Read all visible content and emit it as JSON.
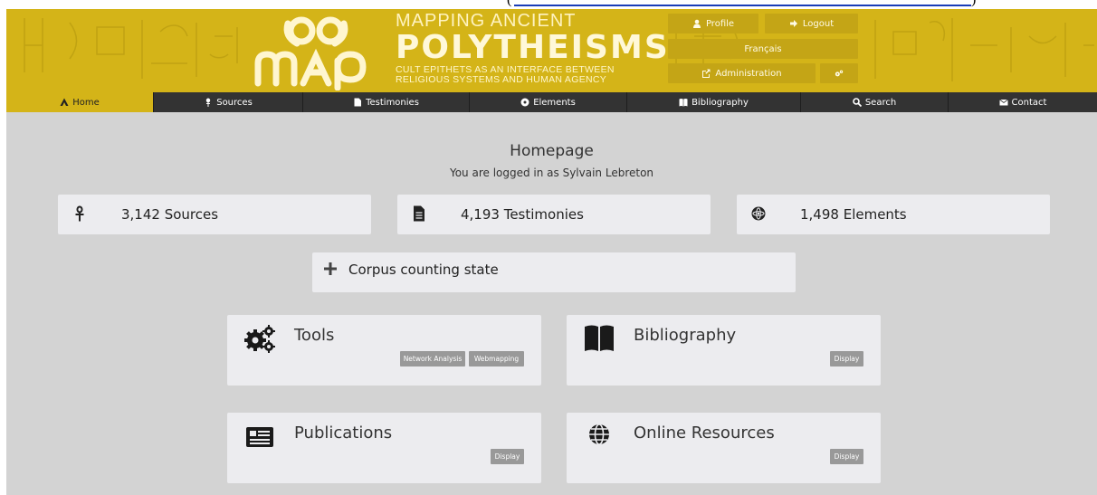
{
  "header": {
    "brand": {
      "line1": "MAPPING ANCIENT",
      "line2": "POLYTHEISMS",
      "line3": "CULT EPITHETS AS AN INTERFACE BETWEEN",
      "line4": "RELIGIOUS SYSTEMS AND HUMAN AGENCY"
    },
    "buttons": {
      "profile": "Profile",
      "logout": "Logout",
      "language": "Français",
      "administration": "Administration"
    }
  },
  "nav": {
    "items": [
      {
        "label": "Home",
        "icon": "home-icon",
        "active": true
      },
      {
        "label": "Sources",
        "icon": "ankh-icon"
      },
      {
        "label": "Testimonies",
        "icon": "document-icon"
      },
      {
        "label": "Elements",
        "icon": "atom-icon"
      },
      {
        "label": "Bibliography",
        "icon": "book-icon"
      },
      {
        "label": "Search",
        "icon": "search-icon"
      },
      {
        "label": "Contact",
        "icon": "envelope-icon"
      }
    ]
  },
  "main": {
    "title": "Homepage",
    "logged_in": "You are logged in as Sylvain Lebreton",
    "stats": {
      "sources": "3,142 Sources",
      "testimonies": "4,193 Testimonies",
      "elements": "1,498 Elements"
    },
    "corpus": "Corpus counting state",
    "cards": {
      "tools": {
        "title": "Tools",
        "tags": [
          "Network Analysis",
          "Webmapping"
        ]
      },
      "bibliography": {
        "title": "Bibliography",
        "tag": "Display"
      },
      "publications": {
        "title": "Publications",
        "tag": "Display"
      },
      "online": {
        "title": "Online Resources",
        "tag": "Display"
      }
    }
  },
  "colors": {
    "header": "#d4b418",
    "nav": "#333333",
    "background": "#d3d3d3",
    "card": "#ececef",
    "tag": "#999999"
  }
}
